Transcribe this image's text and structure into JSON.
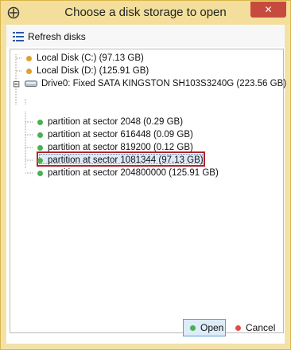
{
  "window": {
    "title": "Choose a disk storage to open",
    "close_glyph": "✕"
  },
  "toolbar": {
    "refresh_label": "Refresh disks",
    "refresh_icon": "list-icon"
  },
  "tree": {
    "items": [
      {
        "label": "Local Disk (C:) (97.13 GB)",
        "color": "#e0a030"
      },
      {
        "label": "Local Disk (D:) (125.91 GB)",
        "color": "#e0a030"
      },
      {
        "label": "Drive0: Fixed SATA KINGSTON SH103S3240G (223.56 GB)",
        "expander": "⊟"
      },
      {
        "label": "partition at sector 2048 (0.29 GB)",
        "color": "#4caf50"
      },
      {
        "label": "partition at sector 616448 (0.09 GB)",
        "color": "#4caf50"
      },
      {
        "label": "partition at sector 819200 (0.12 GB)",
        "color": "#4caf50"
      },
      {
        "label": "partition at sector 1081344 (97.13 GB)",
        "color": "#4caf50",
        "selected": true
      },
      {
        "label": "partition at sector 204800000 (125.91 GB)",
        "color": "#4caf50"
      }
    ]
  },
  "buttons": {
    "open_label": "Open",
    "open_color": "#4caf50",
    "cancel_label": "Cancel",
    "cancel_color": "#e04b4b"
  }
}
